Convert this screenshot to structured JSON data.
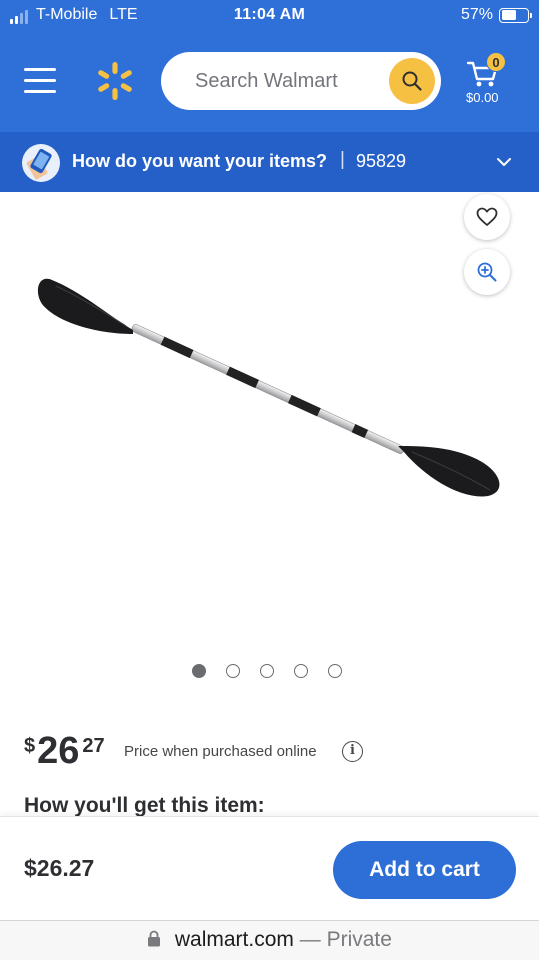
{
  "status": {
    "carrier": "T-Mobile",
    "network": "LTE",
    "time": "11:04 AM",
    "battery_percent": "57%",
    "battery_level": 0.57
  },
  "header": {
    "search_placeholder": "Search Walmart",
    "cart_count": "0",
    "cart_total": "$0.00",
    "brand_color": "#2f6fd8",
    "accent_color": "#f6c142"
  },
  "delivery": {
    "question": "How do you want your items?",
    "separator": "|",
    "zip": "95829"
  },
  "gallery": {
    "image_count": 5,
    "active_index": 0
  },
  "product": {
    "price_currency": "$",
    "price_dollars": "26",
    "price_cents": "27",
    "price_note": "Price when purchased online",
    "info_symbol": "i",
    "fulfillment_heading": "How you'll get this item:"
  },
  "sticky_bar": {
    "price": "$26.27",
    "add_to_cart_label": "Add to cart"
  },
  "browser": {
    "domain": "walmart.com",
    "mode": "— Private"
  }
}
